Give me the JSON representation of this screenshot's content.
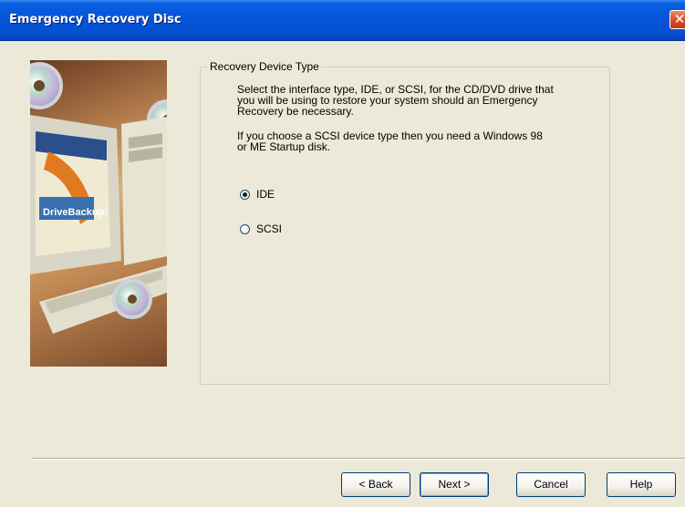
{
  "window": {
    "title": "Emergency Recovery Disc",
    "close_glyph": "✕"
  },
  "group": {
    "label": "Recovery Device Type"
  },
  "text": {
    "p1_l1": "Select the interface type, IDE, or SCSI, for the CD/DVD drive that",
    "p1_l2": "you will be using to restore your system should an Emergency",
    "p1_l3": "Recovery be necessary.",
    "p2_l1": "If you choose a SCSI device type then you need a Windows 98",
    "p2_l2": "or ME Startup disk."
  },
  "options": [
    {
      "label": "IDE",
      "selected": true
    },
    {
      "label": "SCSI",
      "selected": false
    }
  ],
  "art": {
    "brand": "DriveBackup!"
  },
  "buttons": {
    "back": "< Back",
    "next": "Next >",
    "cancel": "Cancel",
    "help": "Help"
  },
  "colors": {
    "title_bar": "#0554d9",
    "dialog_bg": "#ece9d8",
    "close_button": "#d9461e"
  }
}
